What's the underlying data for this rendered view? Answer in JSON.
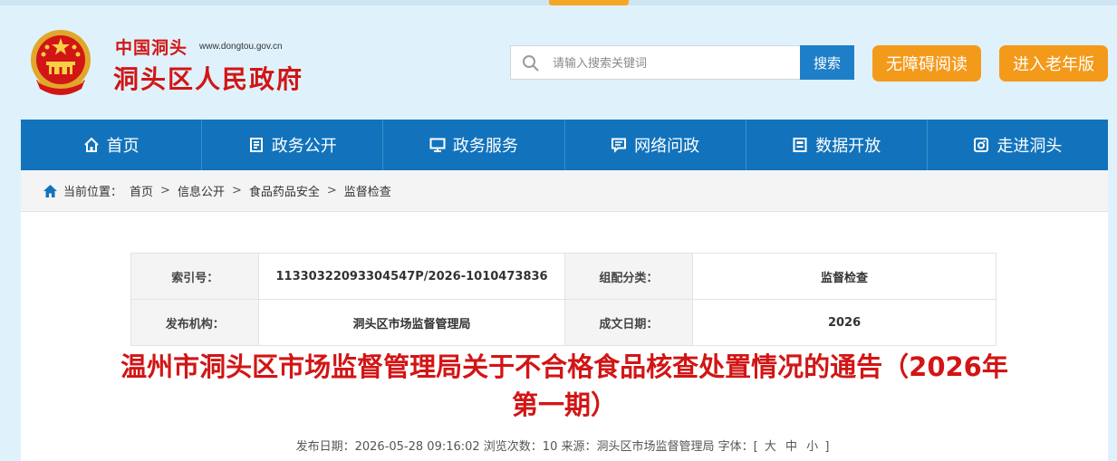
{
  "header": {
    "site_script": "中国洞头",
    "site_url": "www.dongtou.gov.cn",
    "site_name": "洞头区人民政府"
  },
  "search": {
    "placeholder": "请输入搜索关键词",
    "button_label": "搜索"
  },
  "buttons": {
    "accessibility": "无障碍阅读",
    "elder_mode": "进入老年版"
  },
  "nav": [
    {
      "label": "首页",
      "icon": "home-icon"
    },
    {
      "label": "政务公开",
      "icon": "document-icon"
    },
    {
      "label": "政务服务",
      "icon": "monitor-icon"
    },
    {
      "label": "网络问政",
      "icon": "chat-icon"
    },
    {
      "label": "数据开放",
      "icon": "data-icon"
    },
    {
      "label": "走进洞头",
      "icon": "camera-icon"
    }
  ],
  "breadcrumb": {
    "prefix": "当前位置：",
    "items": [
      "首页",
      "信息公开",
      "食品药品安全",
      "监督检查"
    ],
    "separator": ">"
  },
  "meta": {
    "index_label": "索引号：",
    "index_value": "11330322093304547P/2026-1010473836",
    "category_label": "组配分类：",
    "category_value": "监督检查",
    "publisher_label": "发布机构：",
    "publisher_value": "洞头区市场监督管理局",
    "date_label": "成文日期：",
    "date_value": "2026"
  },
  "article": {
    "title": "温州市洞头区市场监督管理局关于不合格食品核查处置情况的通告（2026年第一期）",
    "pubinfo_text": "发布日期：2026-05-28 09:16:02 浏览次数：10 来源：洞头区市场监督管理局 字体：[",
    "font_large": "大",
    "font_medium": "中",
    "font_small": "小",
    "pubinfo_end": "]"
  },
  "colors": {
    "brand_red": "#d21515",
    "nav_blue": "#1273bc",
    "accent_orange": "#f39a1b",
    "search_blue": "#1e7fc8"
  }
}
